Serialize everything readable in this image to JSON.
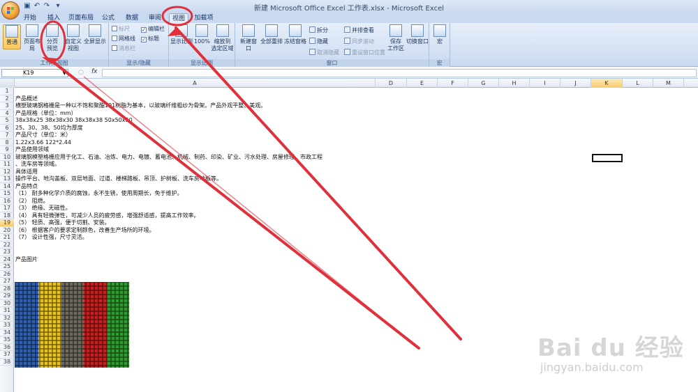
{
  "window": {
    "title": "新建 Microsoft Office Excel 工作表.xlsx - Microsoft Excel"
  },
  "tabs": [
    {
      "label": "开始"
    },
    {
      "label": "插入"
    },
    {
      "label": "页面布局"
    },
    {
      "label": "公式"
    },
    {
      "label": "数据"
    },
    {
      "label": "审阅"
    },
    {
      "label": "视图"
    },
    {
      "label": "加载项"
    }
  ],
  "ribbon": {
    "workbook_views": {
      "label": "工作簿视图",
      "normal": "普通",
      "page_layout": "页面布局",
      "page_break_1": "分页",
      "page_break_2": "预览",
      "custom_1": "自定义",
      "custom_2": "视图",
      "full_screen": "全屏显示"
    },
    "show_hide": {
      "label": "显示/隐藏",
      "ruler": "标尺",
      "gridlines": "网格线",
      "message_bar": "消息栏",
      "formula_bar": "编辑栏",
      "headings": "标题"
    },
    "zoom": {
      "label": "显示比例",
      "zoom": "显示比例",
      "hundred": "100%",
      "zoom_sel_1": "缩放到",
      "zoom_sel_2": "选定区域"
    },
    "window": {
      "label": "窗口",
      "new_window": "新建窗口",
      "arrange_all": "全部重排",
      "freeze": "冻结窗格",
      "split": "拆分",
      "hide": "隐藏",
      "unhide": "取消隐藏",
      "side_by_side": "并排查看",
      "sync_scroll": "同步滚动",
      "reset_pos": "重设窗口位置",
      "save_workspace_1": "保存",
      "save_workspace_2": "工作区",
      "switch_windows": "切换窗口"
    },
    "macros": {
      "label": "宏",
      "macros": "宏"
    }
  },
  "formula_bar": {
    "name_box": "K19",
    "fx": "fx",
    "value": ""
  },
  "columns": [
    "A",
    "D",
    "E",
    "F",
    "G",
    "H",
    "I",
    "J",
    "K",
    "L",
    "M"
  ],
  "selected": {
    "column": "K",
    "row": "19"
  },
  "rows": [
    "1",
    "2",
    "3",
    "4",
    "5",
    "6",
    "7",
    "8",
    "9",
    "10",
    "11",
    "12",
    "13",
    "14",
    "15",
    "16",
    "17",
    "18",
    "19",
    "20",
    "21",
    "22",
    "23",
    "24",
    "25",
    "26",
    "27",
    "28",
    "29",
    "30",
    "31",
    "32",
    "33",
    "34",
    "35",
    "36",
    "37",
    "38"
  ],
  "cells": {
    "r2": "产品概述",
    "r3": "横塑玻璃钢格栅是一种以不饱和聚酯191树脂为基本，以玻璃纤维粗纱为骨架。产品外观平整、美观。",
    "r4": "产品规格（单位：mm）",
    "r5": "38x38x25 38x38x30 38x38x38 50x50x50",
    "r6": "25、30、38、50均为厚度",
    "r7": "产品尺寸（单位：米）",
    "r8": "1.22x3.66  122*2.44",
    "r9": "产品使用领域",
    "r10a": "玻璃钢模塑格栅应用于化工、石油、冶炼、电力、电镀、蓄电池、机械、制药、印染、矿业、污水处理、房屋修理、市政工程",
    "r10b": "、洗车房等领域。",
    "r11": "具体适用",
    "r12": "操作平台、地沟盖板、双层地面、过道、楼梯踏板、吊顶、护树板、洗车房地板等。",
    "r13": "产品特点",
    "r14": "（1） 耐多种化学介质的腐蚀，永不生锈，使用周期长，免于维护。",
    "r15": "（2） 阻燃。",
    "r16": "（3） 绝缘、无磁性。",
    "r17": "（4） 具有轻微弹性，可减少人员的疲劳感，增强舒适感，提高工作效率。",
    "r18": "（5） 轻质、高强，便于切割、安装。",
    "r19": "（6） 根据客户的要求定制颜色，改善生产场所的环境。",
    "r20": "（7） 设计性强，尺寸灵活。",
    "r24": "产品图片"
  },
  "watermark": {
    "text": "Bai du 经验",
    "url": "jingyan.baidu.com"
  },
  "colors": {
    "annotation": "#e0303a",
    "selection": "#f7cc6d",
    "ribbon": "#d3e1f3"
  }
}
